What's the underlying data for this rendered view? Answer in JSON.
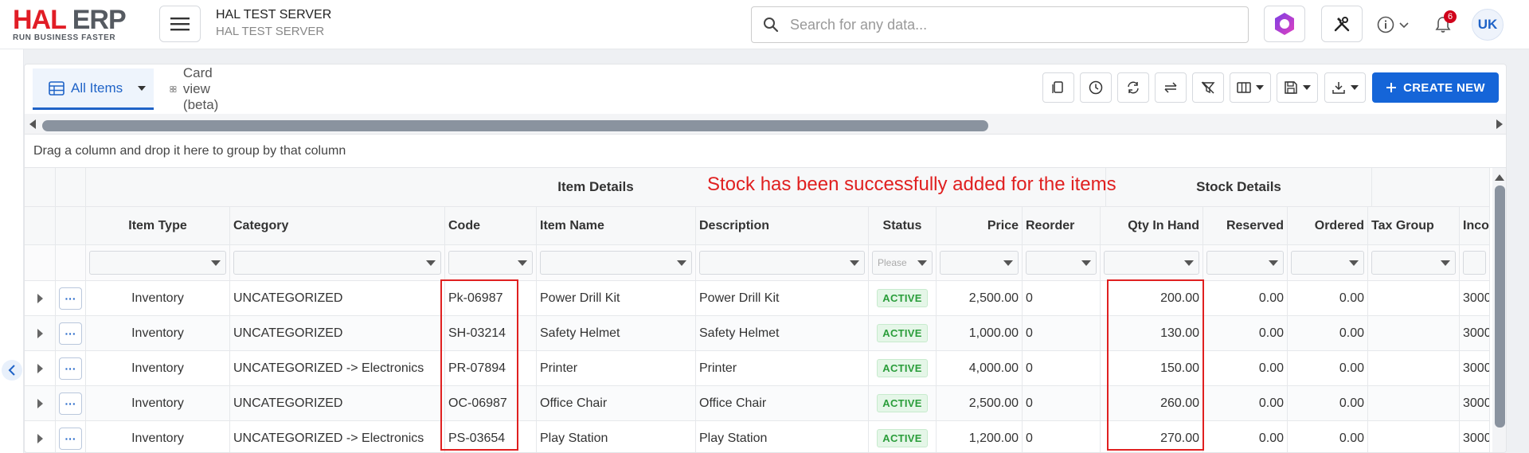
{
  "brand": {
    "logo_left": "HAL",
    "logo_right": "ERP",
    "tagline": "RUN BUSINESS FASTER"
  },
  "server": {
    "title": "HAL TEST SERVER",
    "subtitle": "HAL TEST SERVER"
  },
  "search": {
    "placeholder": "Search for any data..."
  },
  "header": {
    "notifications_count": "6",
    "avatar_initials": "UK"
  },
  "tabs": [
    {
      "label": "All Items"
    },
    {
      "label": "Card view (beta)"
    }
  ],
  "toolbar": {
    "create_label": "CREATE NEW"
  },
  "group_panel": {
    "text": "Drag a column and drop it here to group by that column"
  },
  "annotation": "Stock has been successfully added for the items",
  "bands": {
    "item_details": "Item Details",
    "stock_details": "Stock Details"
  },
  "columns": [
    "Item Type",
    "Category",
    "Code",
    "Item Name",
    "Description",
    "Status",
    "Price",
    "Reorder",
    "Qty In Hand",
    "Reserved",
    "Ordered",
    "Tax Group",
    "Inco"
  ],
  "filters": {
    "status_placeholder": "Please"
  },
  "rows": [
    {
      "type": "Inventory",
      "category": "UNCATEGORIZED",
      "code": "Pk-06987",
      "name": "Power Drill Kit",
      "description": "Power Drill Kit",
      "status": "ACTIVE",
      "price": "2,500.00",
      "reorder": "0",
      "qty": "200.00",
      "reserved": "0.00",
      "ordered": "0.00",
      "tax": "",
      "inco": "3000"
    },
    {
      "type": "Inventory",
      "category": "UNCATEGORIZED",
      "code": "SH-03214",
      "name": "Safety Helmet",
      "description": "Safety Helmet",
      "status": "ACTIVE",
      "price": "1,000.00",
      "reorder": "0",
      "qty": "130.00",
      "reserved": "0.00",
      "ordered": "0.00",
      "tax": "",
      "inco": "3000"
    },
    {
      "type": "Inventory",
      "category": "UNCATEGORIZED -> Electronics",
      "code": "PR-07894",
      "name": "Printer",
      "description": "Printer",
      "status": "ACTIVE",
      "price": "4,000.00",
      "reorder": "0",
      "qty": "150.00",
      "reserved": "0.00",
      "ordered": "0.00",
      "tax": "",
      "inco": "3000"
    },
    {
      "type": "Inventory",
      "category": "UNCATEGORIZED",
      "code": "OC-06987",
      "name": "Office Chair",
      "description": "Office Chair",
      "status": "ACTIVE",
      "price": "2,500.00",
      "reorder": "0",
      "qty": "260.00",
      "reserved": "0.00",
      "ordered": "0.00",
      "tax": "",
      "inco": "3000"
    },
    {
      "type": "Inventory",
      "category": "UNCATEGORIZED -> Electronics",
      "code": "PS-03654",
      "name": "Play Station",
      "description": "Play Station",
      "status": "ACTIVE",
      "price": "1,200.00",
      "reorder": "0",
      "qty": "270.00",
      "reserved": "0.00",
      "ordered": "0.00",
      "tax": "",
      "inco": "3000"
    }
  ],
  "colors": {
    "accent": "#1565d8",
    "brand_red": "#e11d26",
    "annotation": "#e02020",
    "active_green": "#2a9d3a"
  }
}
